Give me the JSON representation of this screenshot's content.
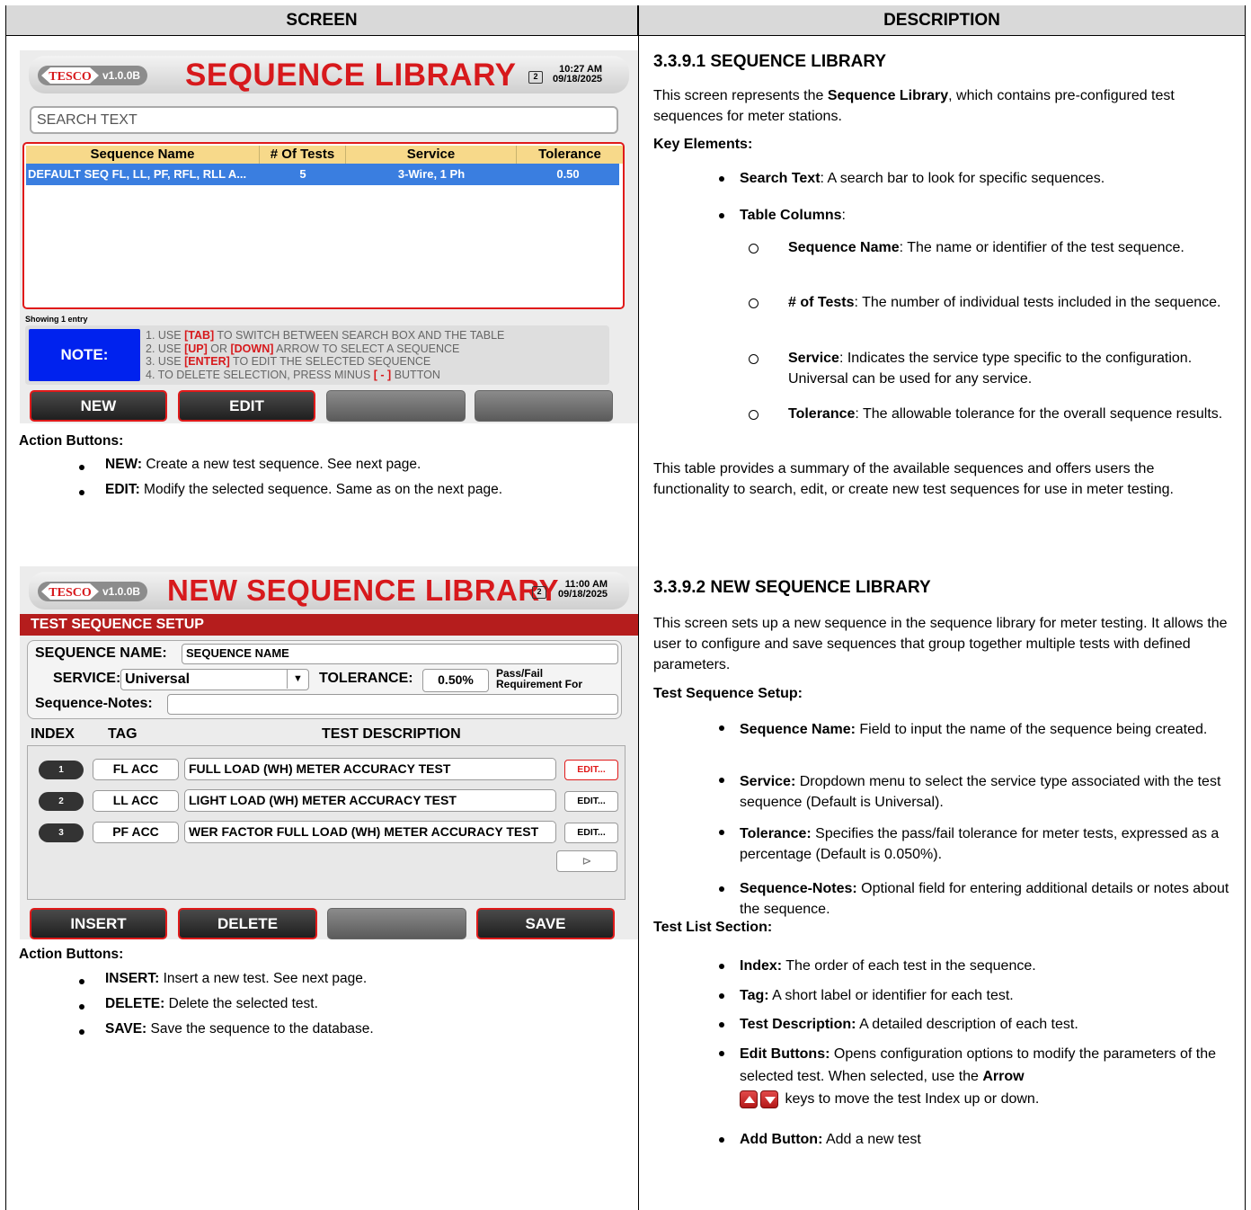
{
  "headers": {
    "screen": "SCREEN",
    "description": "DESCRIPTION"
  },
  "screen1": {
    "logo_text": "TESCO",
    "version": "v1.0.0B",
    "title": "SEQUENCE LIBRARY",
    "time": "10:27 AM",
    "date": "09/18/2025",
    "screen_index": "2",
    "search_placeholder": "SEARCH TEXT",
    "table": {
      "columns": [
        "Sequence Name",
        "# Of Tests",
        "Service",
        "Tolerance"
      ],
      "rows": [
        [
          "DEFAULT SEQ FL, LL, PF, RFL, RLL A...",
          "5",
          "3-Wire, 1 Ph",
          "0.50"
        ]
      ]
    },
    "showing": "Showing 1 entry",
    "note_label": "NOTE:",
    "notes": [
      {
        "pre": "1. USE ",
        "key": "[TAB]",
        "post": " TO SWITCH BETWEEN SEARCH BOX AND THE TABLE"
      },
      {
        "pre": "2. USE ",
        "key": "[UP]",
        "mid": " OR ",
        "key2": "[DOWN]",
        "post": " ARROW TO SELECT A SEQUENCE"
      },
      {
        "pre": "3. USE ",
        "key": "[ENTER]",
        "post": " TO EDIT THE SELECTED SEQUENCE"
      },
      {
        "pre": "4. TO DELETE SELECTION, PRESS MINUS ",
        "key": "[ - ]",
        "post": " BUTTON"
      }
    ],
    "buttons": [
      "NEW",
      "EDIT",
      "",
      ""
    ]
  },
  "caption1": {
    "heading": "Action Buttons:",
    "items": [
      {
        "label": "NEW:",
        "text": " Create a new test sequence. See next page."
      },
      {
        "label": "EDIT:",
        "text": " Modify the selected sequence. Same as on the next page."
      }
    ]
  },
  "screen2": {
    "logo_text": "TESCO",
    "version": "v1.0.0B",
    "title": "NEW SEQUENCE LIBRARY",
    "time": "11:00 AM",
    "date": "09/18/2025",
    "screen_index": "2",
    "section": "TEST SEQUENCE SETUP",
    "seq_name_label": "SEQUENCE NAME:",
    "seq_name_value": "SEQUENCE NAME",
    "service_label": "SERVICE:",
    "service_value": "Universal",
    "tolerance_label": "TOLERANCE:",
    "tolerance_value": "0.50%",
    "passfail_line1": "Pass/Fail",
    "passfail_line2": "Requirement For",
    "notes_label": "Sequence-Notes:",
    "notes_value": "",
    "col_index": "INDEX",
    "col_tag": "TAG",
    "col_desc": "TEST DESCRIPTION",
    "tests": [
      {
        "index": "1",
        "tag": "FL ACC",
        "desc": "FULL LOAD (WH) METER ACCURACY TEST",
        "edit": "EDIT..."
      },
      {
        "index": "2",
        "tag": "LL ACC",
        "desc": "LIGHT LOAD (WH) METER ACCURACY TEST",
        "edit": "EDIT..."
      },
      {
        "index": "3",
        "tag": "PF ACC",
        "desc": "WER FACTOR FULL LOAD (WH) METER ACCURACY TEST",
        "edit": "EDIT..."
      }
    ],
    "add_glyph": "⊳",
    "buttons": [
      "INSERT",
      "DELETE",
      "",
      "SAVE"
    ]
  },
  "caption2": {
    "heading": "Action Buttons:",
    "items": [
      {
        "label": "INSERT:",
        "text": " Insert a new test. See next page."
      },
      {
        "label": "DELETE:",
        "text": " Delete the selected test."
      },
      {
        "label": "SAVE:",
        "text": " Save the sequence to the database."
      }
    ]
  },
  "desc1": {
    "heading": "3.3.9.1 SEQUENCE LIBRARY",
    "intro_a": "This screen represents the ",
    "intro_b": "Sequence Library",
    "intro_c": ", which contains pre-configured test sequences for meter stations.",
    "key_heading": "Key Elements:",
    "search_label": "Search Text",
    "search_text": ": A search bar to look for specific sequences.",
    "columns_label": "Table Columns",
    "columns_text": ":",
    "subitems": [
      {
        "label": "Sequence Name",
        "text": ": The name or identifier of the test sequence."
      },
      {
        "label": "# of Tests",
        "text": ": The number of individual tests included in the sequence."
      },
      {
        "label": "Service",
        "text": ": Indicates the service type specific to the configuration. Universal can be used for any service."
      },
      {
        "label": "Tolerance",
        "text": ": The allowable tolerance for the overall sequence results."
      }
    ],
    "summary": "This table provides a summary of the available sequences and offers users the functionality to search, edit, or create new test sequences for use in meter testing."
  },
  "desc2": {
    "heading": "3.3.9.2 NEW SEQUENCE LIBRARY",
    "intro": "This screen sets up a new sequence in the sequence library for meter testing. It allows the user to configure and save sequences that group together multiple tests with defined parameters.",
    "setup_heading": "Test Sequence Setup:",
    "setup_items": [
      {
        "label": "Sequence Name:",
        "text": " Field to input the name of the sequence being created."
      },
      {
        "label": "Service:",
        "text": " Dropdown menu to select the service type associated with the test sequence (Default is Universal)."
      },
      {
        "label": "Tolerance:",
        "text": " Specifies the pass/fail tolerance for meter tests, expressed as a percentage (Default is 0.050%)."
      },
      {
        "label": "Sequence-Notes:",
        "text": " Optional field for entering additional details or notes about the sequence."
      }
    ],
    "list_heading": "Test List Section:",
    "list_items": [
      {
        "label": "Index:",
        "text": " The order of each test in the sequence."
      },
      {
        "label": "Tag:",
        "text": " A short label or identifier for each test."
      },
      {
        "label": "Test Description:",
        "text": " A detailed description of each test."
      }
    ],
    "edit_label": "Edit Buttons:",
    "edit_text": " Opens configuration options to modify the parameters of the selected test. When selected, use the ",
    "edit_arrow": "Arrow",
    "edit_tail": " keys to move the test Index up or down.",
    "add_label": "Add Button:",
    "add_text": " Add a new test"
  }
}
